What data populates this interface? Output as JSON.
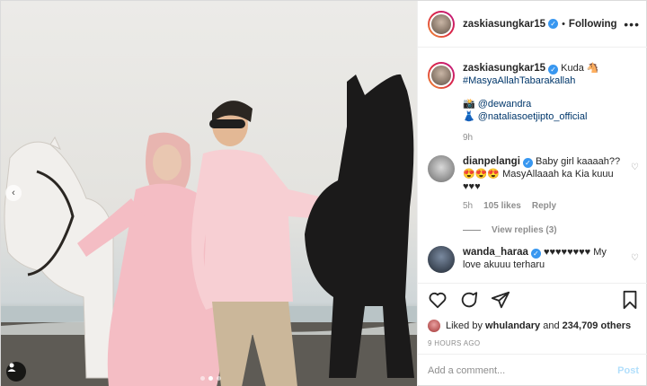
{
  "post": {
    "username": "zaskiasungkar15",
    "separator": "•",
    "follow_status": "Following",
    "caption_text": "Kuda 🐴",
    "hashtag": "#MasyaAllahTabarakallah",
    "tags": [
      {
        "emoji": "📸",
        "handle": "@dewandra"
      },
      {
        "emoji": "👗",
        "handle": "@nataliasoetjipto_official"
      }
    ],
    "caption_time": "9h"
  },
  "comments": [
    {
      "username": "dianpelangi",
      "text_line1": "Baby girl kaaaah??",
      "text_line2": "😍😍😍 MasyAllaaah ka Kia kuuu",
      "text_line3": "♥♥♥",
      "time": "5h",
      "likes": "105 likes",
      "reply": "Reply",
      "view_replies": "View replies (3)"
    },
    {
      "username": "wanda_haraa",
      "text": "♥♥♥♥♥♥♥♥ My",
      "text_line2": "love akuuu terharu"
    }
  ],
  "likes": {
    "prefix": "Liked by",
    "user": "whulandary",
    "conj": "and",
    "others": "234,709 others"
  },
  "timestamp": "9 HOURS AGO",
  "composer": {
    "placeholder": "Add a comment...",
    "post_label": "Post"
  },
  "icons": {
    "verified": "verified-badge-icon",
    "more": "more-options-icon",
    "like": "heart-icon",
    "comment": "comment-icon",
    "share": "share-icon",
    "save": "bookmark-icon",
    "prev": "chevron-left-icon",
    "tag": "user-tag-icon"
  },
  "colors": {
    "accent": "#3897f0",
    "link": "#00376b",
    "muted": "#8e8e8e",
    "post_disabled": "#b2dffc"
  }
}
